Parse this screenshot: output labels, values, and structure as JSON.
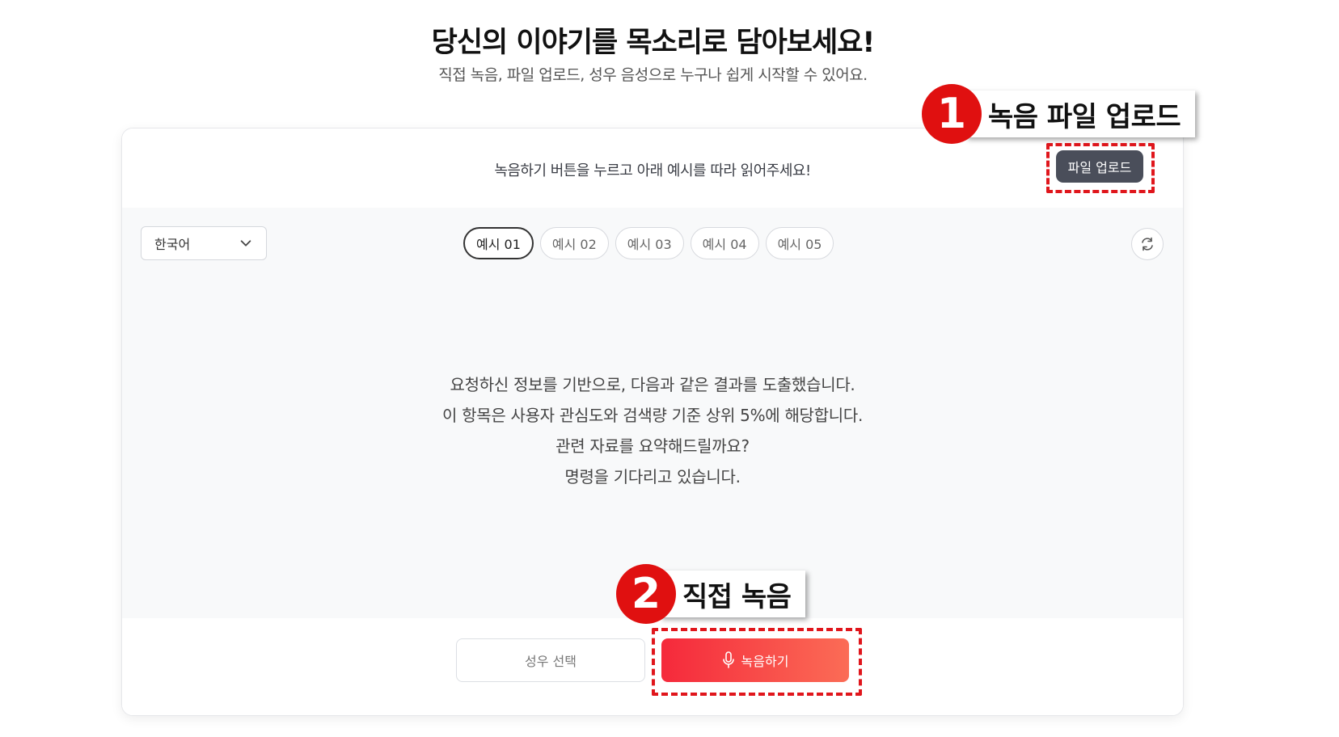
{
  "header": {
    "title": "당신의 이야기를 목소리로 담아보세요!",
    "subtitle": "직접 녹음, 파일 업로드, 성우 음성으로 누구나 쉽게 시작할 수 있어요."
  },
  "card": {
    "instruction": "녹음하기 버튼을 누르고 아래 예시를 따라 읽어주세요!",
    "upload_label": "파일 업로드",
    "language": "한국어",
    "tabs": [
      {
        "label": "예시 01"
      },
      {
        "label": "예시 02"
      },
      {
        "label": "예시 03"
      },
      {
        "label": "예시 04"
      },
      {
        "label": "예시 05"
      }
    ],
    "active_tab": "예시 01",
    "script_lines": [
      "요청하신 정보를 기반으로, 다음과 같은 결과를 도출했습니다.",
      "이 항목은 사용자 관심도와 검색량 기준 상위 5%에 해당합니다.",
      "관련 자료를 요약해드릴까요?",
      "명령을 기다리고 있습니다."
    ],
    "voice_select_label": "성우 선택",
    "record_label": "녹음하기"
  },
  "annotations": [
    {
      "number": "1",
      "label": "녹음 파일 업로드"
    },
    {
      "number": "2",
      "label": "직접 녹음"
    }
  ],
  "colors": {
    "accent_red": "#f5293b",
    "accent_red_end": "#fb6c56",
    "upload_button": "#4a4e5a",
    "callout_red": "#e01010"
  },
  "icons": [
    "chevron-down-icon",
    "refresh-icon",
    "microphone-icon"
  ]
}
